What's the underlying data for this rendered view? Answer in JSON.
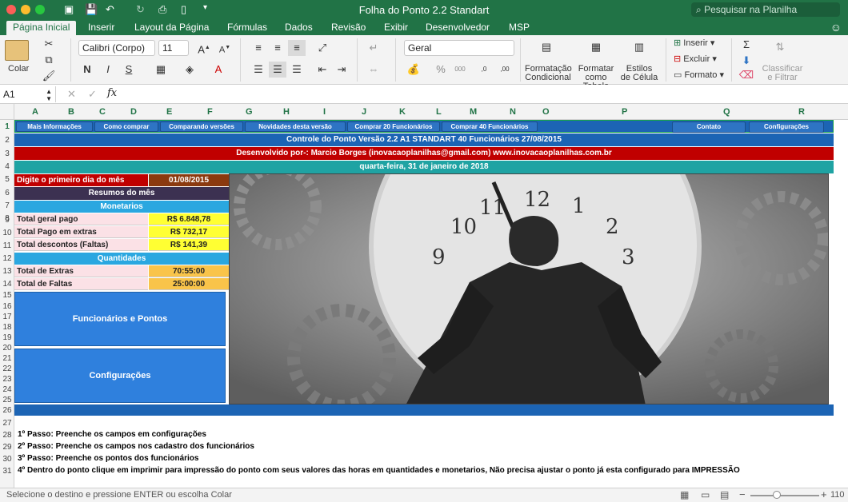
{
  "window": {
    "title": "Folha do Ponto 2.2 Standart",
    "search_placeholder": "Pesquisar na Planilha"
  },
  "tabs": [
    "Página Inicial",
    "Inserir",
    "Layout da Página",
    "Fórmulas",
    "Dados",
    "Revisão",
    "Exibir",
    "Desenvolvedor",
    "MSP"
  ],
  "ribbon": {
    "paste_label": "Colar",
    "font_name": "Calibri (Corpo)",
    "font_size": "11",
    "number_format": "Geral",
    "cond_format": [
      "Formatação",
      "Condicional"
    ],
    "format_table": [
      "Formatar",
      "como Tabela"
    ],
    "cell_styles": [
      "Estilos",
      "de Célula"
    ],
    "insert_label": "Inserir",
    "delete_label": "Excluir",
    "format_label": "Formato",
    "sort_filter": [
      "Classificar",
      "e Filtrar"
    ]
  },
  "formula_bar": {
    "name_box": "A1",
    "fx": "fx"
  },
  "columns": [
    "A",
    "B",
    "C",
    "D",
    "E",
    "F",
    "G",
    "H",
    "I",
    "J",
    "K",
    "L",
    "M",
    "N",
    "O",
    "P",
    "Q",
    "R"
  ],
  "rows": [
    "1",
    "2",
    "3",
    "4",
    "5",
    "6",
    "7",
    "8",
    "9",
    "10",
    "11",
    "12",
    "13",
    "14",
    "15",
    "16",
    "17",
    "18",
    "19",
    "20",
    "21",
    "22",
    "23",
    "24",
    "25",
    "26",
    "27",
    "28",
    "29",
    "30",
    "31"
  ],
  "sheet": {
    "nav_buttons": [
      "Mais Informações",
      "Como comprar",
      "Comparando versões",
      "Novidades desta versão",
      "Comprar 20 Funcionários",
      "Comprar 40 Funcionários"
    ],
    "contact_button": "Contato",
    "config_button": "Configurações",
    "title_banner": "Controle do Ponto Versão 2.2 A1 STANDART  40 Funcionários 27/08/2015",
    "developer_banner": "Desenvolvido por-:  Marcio Borges  (inovacaoplanilhas@gmail.com)       www.inovacaoplanilhas.com.br",
    "date_banner": "quarta-feira, 31 de janeiro de 2018",
    "first_day_label": "Digite o primeiro dia do mês",
    "first_day_value": "01/08/2015",
    "summary_header": "Resumos do mês",
    "monetary_header": "Monetarios",
    "total_paid_label": "Total geral pago",
    "total_paid_value": "R$ 6.848,78",
    "extras_paid_label": "Total Pago em extras",
    "extras_paid_value": "R$ 732,17",
    "discounts_label": "Total descontos  (Faltas)",
    "discounts_value": "R$ 141,39",
    "quantities_header": "Quantidades",
    "total_extras_label": "Total de Extras",
    "total_extras_value": "70:55:00",
    "total_absences_label": "Total de Faltas",
    "total_absences_value": "25:00:00",
    "employees_button": "Funcionários e Pontos",
    "settings_button": "Configurações",
    "steps": [
      "1º Passo: Preenche os campos em configurações",
      "2º Passo: Preenche os campos nos cadastro dos funcionários",
      "3º Passo: Preenche os pontos dos funcionários",
      "4º Dentro do ponto clique em imprimir para impressão do ponto com seus valores das horas em quantidades e monetarios, Não precisa ajustar o ponto já esta configurado para IMPRESSÃO"
    ],
    "clock_numbers": [
      "12",
      "11",
      "10",
      "9",
      "2",
      "3",
      "1"
    ]
  },
  "status": {
    "message": "Selecione o destino e pressione ENTER ou escolha Colar",
    "zoom": "110"
  },
  "colors": {
    "excel_green": "#217346",
    "blue_bar": "#1c64b4",
    "red_bar": "#c00000",
    "teal_bar": "#1fa3a3"
  }
}
